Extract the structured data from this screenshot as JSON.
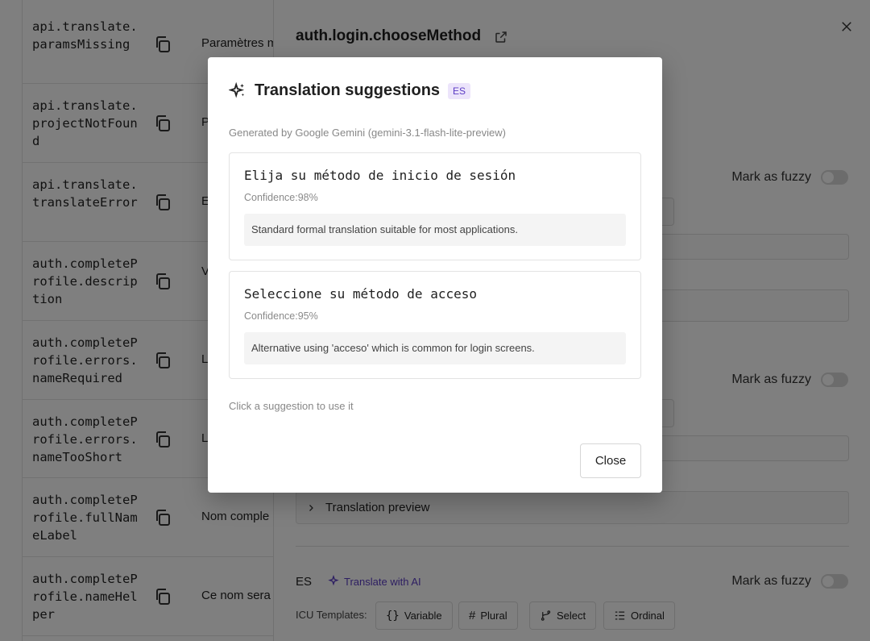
{
  "key_list": [
    {
      "key": "api.translate.paramsMissing",
      "value": "Paramètres m"
    },
    {
      "key": "api.translate.projectNotFound",
      "value": "P"
    },
    {
      "key": "api.translate.translateError",
      "value": "E"
    },
    {
      "key": "auth.completeProfile.description",
      "value": "V"
    },
    {
      "key": "auth.completeProfile.errors.nameRequired",
      "value": "L"
    },
    {
      "key": "auth.completeProfile.errors.nameTooShort",
      "value": "L"
    },
    {
      "key": "auth.completeProfile.fullNameLabel",
      "value": "Nom comple"
    },
    {
      "key": "auth.completeProfile.nameHelper",
      "value": "Ce nom sera"
    }
  ],
  "editor": {
    "title": "auth.login.chooseMethod",
    "mark_fuzzy_label": "Mark as fuzzy",
    "translation_preview_label": "Translation preview",
    "lang_code": "ES",
    "translate_ai_label": "Translate with AI",
    "icu_label": "ICU Templates:",
    "icu_buttons": [
      "Variable",
      "Plural",
      "Select",
      "Ordinal"
    ]
  },
  "modal": {
    "title": "Translation suggestions",
    "lang_badge": "ES",
    "generated_by": "Generated by Google Gemini (gemini-3.1-flash-lite-preview)",
    "suggestions": [
      {
        "text": "Elija su método de inicio de sesión",
        "confidence": "Confidence:98%",
        "note": "Standard formal translation suitable for most applications."
      },
      {
        "text": "Seleccione su método de acceso",
        "confidence": "Confidence:95%",
        "note": "Alternative using 'acceso' which is common for login screens."
      }
    ],
    "hint": "Click a suggestion to use it",
    "close_label": "Close"
  },
  "colors": {
    "accent": "#5b3cc4",
    "badge_bg": "#ece4fb",
    "overlay": "rgba(0,0,0,0.5)"
  },
  "icons": [
    "copy-icon",
    "external-link-icon",
    "close-icon",
    "sparkle-icon",
    "chevron-right-icon",
    "braces-icon",
    "hash-icon",
    "branch-icon",
    "list-ordered-icon"
  ]
}
